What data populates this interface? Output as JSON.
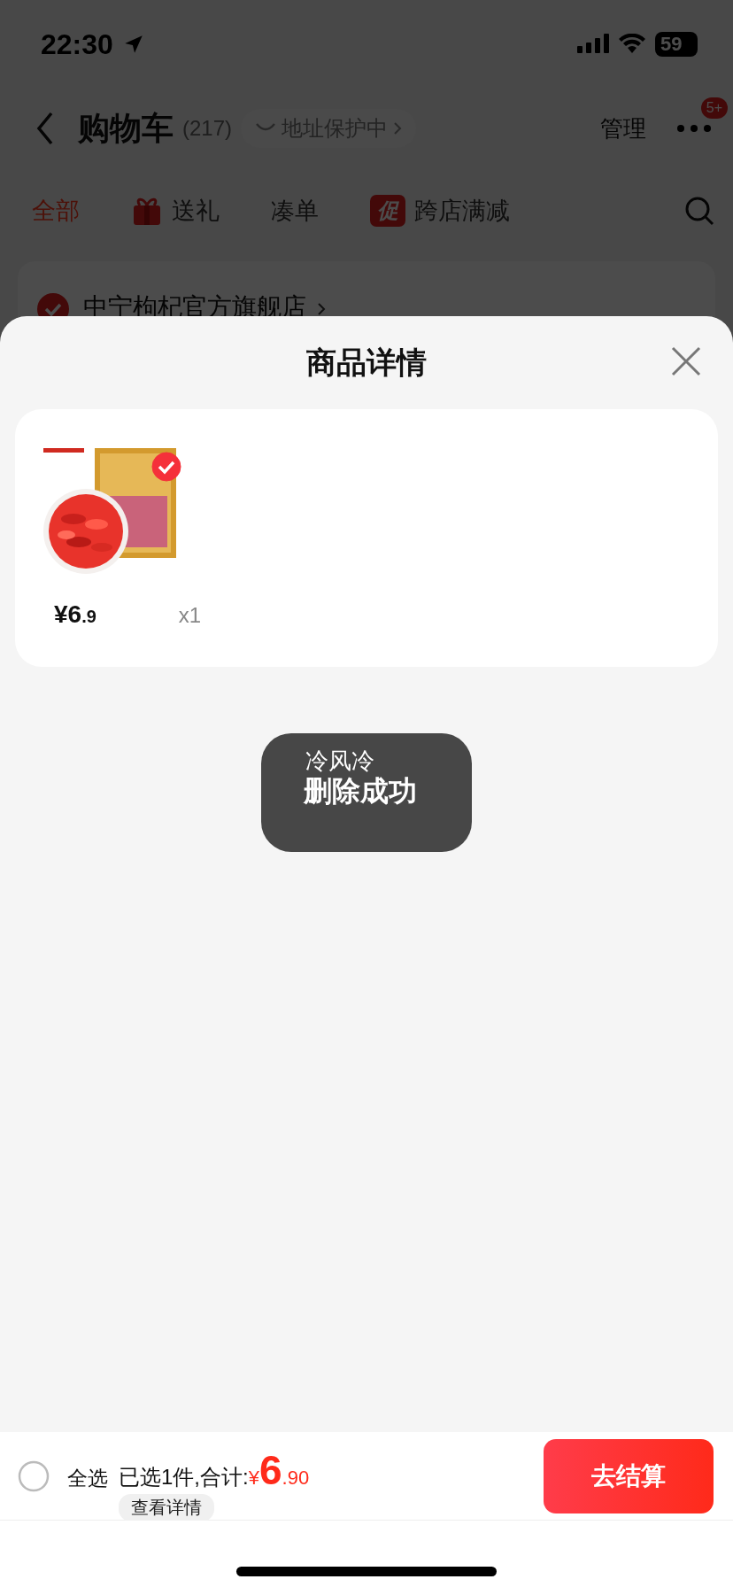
{
  "status_bar": {
    "time": "22:30",
    "battery": "59"
  },
  "header": {
    "title": "购物车",
    "count": "(217)",
    "address_badge": "地址保护中",
    "manage": "管理",
    "notification_badge": "5+"
  },
  "tabs": [
    {
      "label": "全部",
      "selected": true,
      "kind": "plain"
    },
    {
      "label": "送礼",
      "selected": false,
      "kind": "gift"
    },
    {
      "label": "凑单",
      "selected": false,
      "kind": "plain"
    },
    {
      "label": "跨店满减",
      "selected": false,
      "kind": "promo",
      "icon_text": "促"
    }
  ],
  "store": {
    "name": "中宁枸杞官方旗舰店",
    "checked": true
  },
  "sheet": {
    "title": "商品详情",
    "items": [
      {
        "kind": "picture",
        "checked": true,
        "price_main": "¥6",
        "price_decimal": ".9",
        "quantity": "x1"
      }
    ]
  },
  "toast": {
    "lines": [
      "冷风冷",
      "删除成功"
    ]
  },
  "footer": {
    "select_all": {
      "label": "全选",
      "checked": false
    },
    "summary": "已选1件,合计:",
    "currency": "¥",
    "total_main": "6",
    "total_decimal": ".90",
    "details": "查看详情",
    "checkout": "去结算"
  }
}
